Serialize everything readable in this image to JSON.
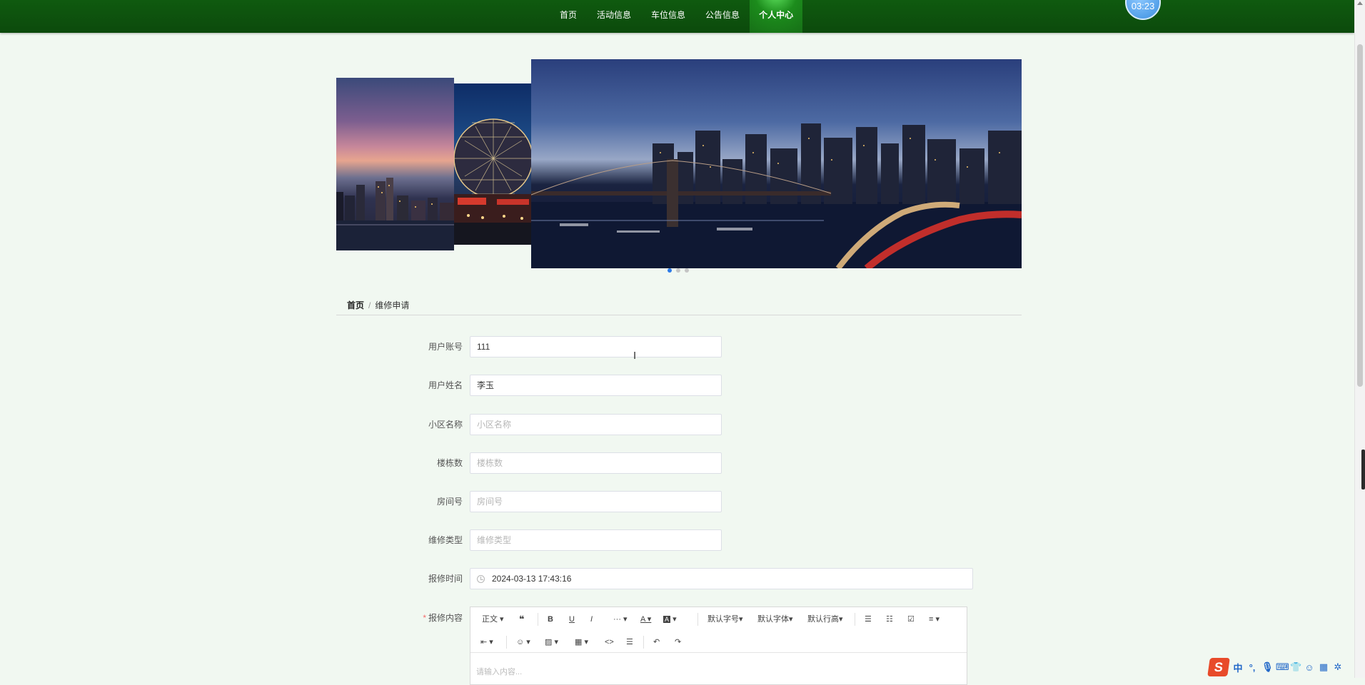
{
  "nav": {
    "items": [
      {
        "label": "首页"
      },
      {
        "label": "活动信息"
      },
      {
        "label": "车位信息"
      },
      {
        "label": "公告信息"
      },
      {
        "label": "个人中心",
        "active": true
      }
    ]
  },
  "clock": {
    "time": "03:23"
  },
  "carousel": {
    "slide_count": 3,
    "active_index": 0,
    "dot_color": "#2d7be8"
  },
  "breadcrumb": {
    "home": "首页",
    "sep": "/",
    "current": "维修申请"
  },
  "form": {
    "username": {
      "label": "用户账号",
      "value": "111"
    },
    "realname": {
      "label": "用户姓名",
      "value": "李玉"
    },
    "community": {
      "label": "小区名称",
      "placeholder": "小区名称"
    },
    "building": {
      "label": "楼栋数",
      "placeholder": "楼栋数"
    },
    "room": {
      "label": "房间号",
      "placeholder": "房间号"
    },
    "repair_type": {
      "label": "维修类型",
      "placeholder": "维修类型"
    },
    "report_time": {
      "label": "报修时间",
      "value": "2024-03-13 17:43:16"
    },
    "content": {
      "label": "报修内容",
      "required_mark": "*",
      "placeholder": "请输入内容..."
    }
  },
  "editor_toolbar": {
    "paragraph": "正文",
    "font_size": "默认字号",
    "font_family": "默认字体",
    "line_height": "默认行高",
    "more": "···"
  },
  "tray": {
    "ime_lang": "中"
  },
  "colors": {
    "nav_bg": "#0e540e",
    "page_bg": "#f1f8f1",
    "accent": "#2d7be8",
    "required": "#f56c6c"
  }
}
